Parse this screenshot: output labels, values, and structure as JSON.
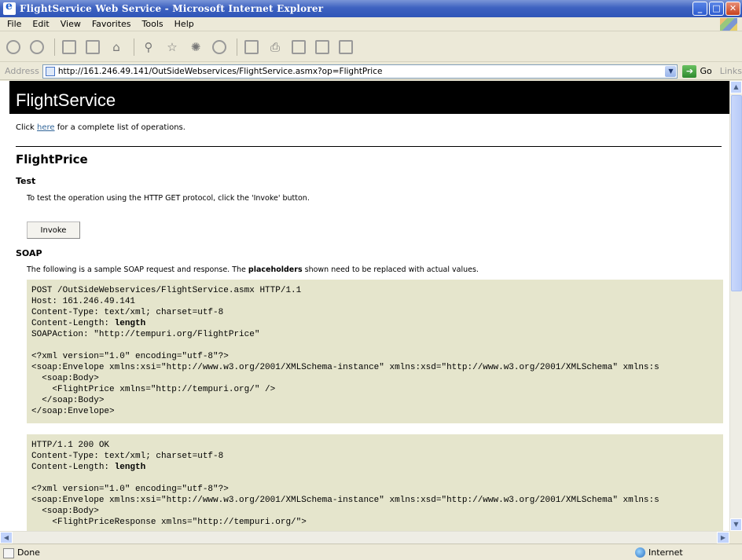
{
  "window": {
    "title": "FlightService Web Service - Microsoft Internet Explorer"
  },
  "menu": [
    "File",
    "Edit",
    "View",
    "Favorites",
    "Tools",
    "Help"
  ],
  "address": {
    "label": "Address",
    "url": "http://161.246.49.141/OutSideWebservices/FlightService.asmx?op=FlightPrice",
    "go": "Go",
    "links": "Links"
  },
  "page": {
    "service_name": "FlightService",
    "intro_prefix": "Click ",
    "intro_link": "here",
    "intro_suffix": " for a complete list of operations.",
    "operation": "FlightPrice",
    "test_heading": "Test",
    "test_desc": "To test the operation using the HTTP GET protocol, click the 'Invoke' button.",
    "invoke_label": "Invoke",
    "soap_heading": "SOAP",
    "soap_desc_prefix": "The following is a sample SOAP request and response. The ",
    "soap_desc_bold": "placeholders",
    "soap_desc_suffix": " shown need to be replaced with actual values.",
    "request": {
      "line1": "POST /OutSideWebservices/FlightService.asmx HTTP/1.1",
      "line2": "Host: 161.246.49.141",
      "line3": "Content-Type: text/xml; charset=utf-8",
      "line4_prefix": "Content-Length: ",
      "line4_ph": "length",
      "line5": "SOAPAction: \"http://tempuri.org/FlightPrice\"",
      "line6": "",
      "line7": "<?xml version=\"1.0\" encoding=\"utf-8\"?>",
      "line8": "<soap:Envelope xmlns:xsi=\"http://www.w3.org/2001/XMLSchema-instance\" xmlns:xsd=\"http://www.w3.org/2001/XMLSchema\" xmlns:s",
      "line9": "  <soap:Body>",
      "line10": "    <FlightPrice xmlns=\"http://tempuri.org/\" />",
      "line11": "  </soap:Body>",
      "line12": "</soap:Envelope>"
    },
    "response": {
      "line1": "HTTP/1.1 200 OK",
      "line2": "Content-Type: text/xml; charset=utf-8",
      "line3_prefix": "Content-Length: ",
      "line3_ph": "length",
      "line4": "",
      "line5": "<?xml version=\"1.0\" encoding=\"utf-8\"?>",
      "line6": "<soap:Envelope xmlns:xsi=\"http://www.w3.org/2001/XMLSchema-instance\" xmlns:xsd=\"http://www.w3.org/2001/XMLSchema\" xmlns:s",
      "line7": "  <soap:Body>",
      "line8": "    <FlightPriceResponse xmlns=\"http://tempuri.org/\">"
    }
  },
  "status": {
    "text": "Done",
    "zone": "Internet"
  },
  "colors": {
    "code_bg": "#e5e5cc",
    "heading_bg": "#000000",
    "link": "#336699"
  }
}
